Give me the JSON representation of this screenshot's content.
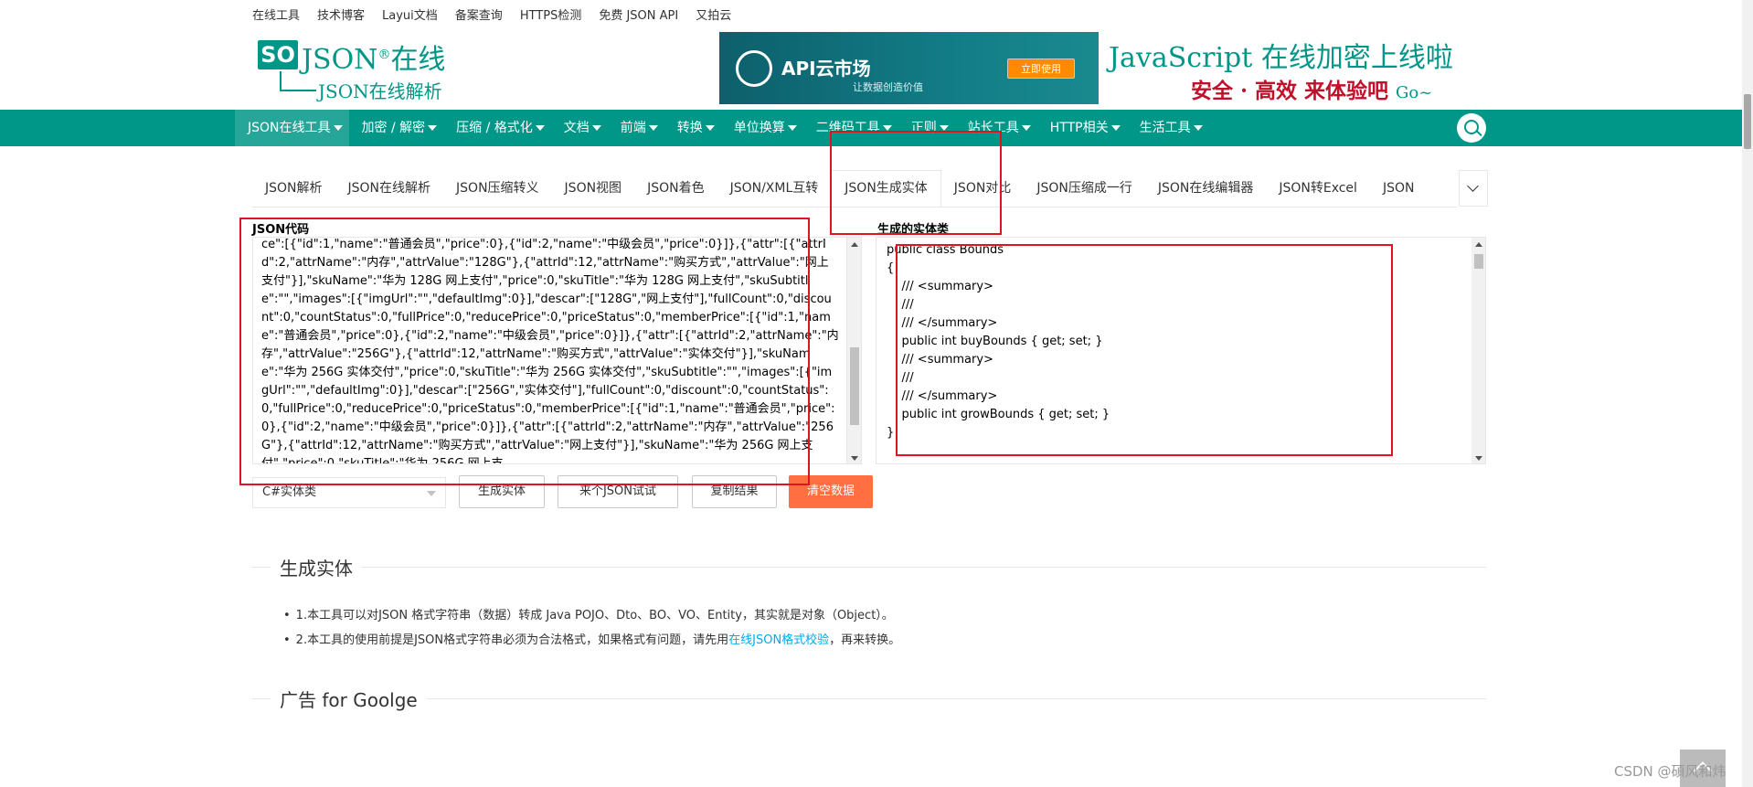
{
  "top_links": [
    "在线工具",
    "技术博客",
    "Layui文档",
    "备案查询",
    "HTTPS检测",
    "免费 JSON API",
    "又拍云"
  ],
  "logo": {
    "badge": "SO",
    "title": "JSON",
    "reg": "®",
    "title_cn": "在线",
    "subtitle": "JSON在线解析"
  },
  "banner": {
    "title": "API云市场",
    "subtitle": "让数据创造价值",
    "button": "立即使用"
  },
  "slogan": {
    "line1": "JavaScript 在线加密上线啦",
    "line2": "安全 · 高效  来体验吧",
    "go": "Go~"
  },
  "nav": [
    {
      "label": "JSON在线工具",
      "active": true
    },
    {
      "label": "加密 / 解密"
    },
    {
      "label": "压缩 / 格式化"
    },
    {
      "label": "文档"
    },
    {
      "label": "前端"
    },
    {
      "label": "转换"
    },
    {
      "label": "单位换算"
    },
    {
      "label": "二维码工具"
    },
    {
      "label": "正则"
    },
    {
      "label": "站长工具"
    },
    {
      "label": "HTTP相关"
    },
    {
      "label": "生活工具"
    }
  ],
  "tabs": [
    "JSON解析",
    "JSON在线解析",
    "JSON压缩转义",
    "JSON视图",
    "JSON着色",
    "JSON/XML互转",
    "JSON生成实体",
    "JSON对比",
    "JSON压缩成一行",
    "JSON在线编辑器",
    "JSON转Excel",
    "JSON"
  ],
  "active_tab": "JSON生成实体",
  "input": {
    "label": "JSON代码",
    "text": "ce\":[{\"id\":1,\"name\":\"普通会员\",\"price\":0},{\"id\":2,\"name\":\"中级会员\",\"price\":0}]},{\"attr\":[{\"attrId\":2,\"attrName\":\"内存\",\"attrValue\":\"128G\"},{\"attrId\":12,\"attrName\":\"购买方式\",\"attrValue\":\"网上支付\"}],\"skuName\":\"华为 128G 网上支付\",\"price\":0,\"skuTitle\":\"华为 128G 网上支付\",\"skuSubtitle\":\"\",\"images\":[{\"imgUrl\":\"\",\"defaultImg\":0}],\"descar\":[\"128G\",\"网上支付\"],\"fullCount\":0,\"discount\":0,\"countStatus\":0,\"fullPrice\":0,\"reducePrice\":0,\"priceStatus\":0,\"memberPrice\":[{\"id\":1,\"name\":\"普通会员\",\"price\":0},{\"id\":2,\"name\":\"中级会员\",\"price\":0}]},{\"attr\":[{\"attrId\":2,\"attrName\":\"内存\",\"attrValue\":\"256G\"},{\"attrId\":12,\"attrName\":\"购买方式\",\"attrValue\":\"实体交付\"}],\"skuName\":\"华为 256G 实体交付\",\"price\":0,\"skuTitle\":\"华为 256G 实体交付\",\"skuSubtitle\":\"\",\"images\":[{\"imgUrl\":\"\",\"defaultImg\":0}],\"descar\":[\"256G\",\"实体交付\"],\"fullCount\":0,\"discount\":0,\"countStatus\":0,\"fullPrice\":0,\"reducePrice\":0,\"priceStatus\":0,\"memberPrice\":[{\"id\":1,\"name\":\"普通会员\",\"price\":0},{\"id\":2,\"name\":\"中级会员\",\"price\":0}]},{\"attr\":[{\"attrId\":2,\"attrName\":\"内存\",\"attrValue\":\"256G\"},{\"attrId\":12,\"attrName\":\"购买方式\",\"attrValue\":\"网上支付\"}],\"skuName\":\"华为 256G 网上支付\",\"price\":0,\"skuTitle\":\"华为 256G 网上支"
  },
  "output": {
    "label": "生成的实体类",
    "code": "public class Bounds\n{\n    /// <summary>\n    /// \n    /// </summary>\n    public int buyBounds { get; set; }\n    /// <summary>\n    /// \n    /// </summary>\n    public int growBounds { get; set; }\n}"
  },
  "controls": {
    "language": "C#实体类",
    "generate": "生成实体",
    "try_json": "来个JSON试试",
    "copy": "复制结果",
    "clear": "清空数据"
  },
  "section1": {
    "title": "生成实体",
    "note1": "1.本工具可以对JSON 格式字符串（数据）转成 Java POJO、Dto、BO、VO、Entity，其实就是对象（Object）。",
    "note2_pre": "2.本工具的使用前提是JSON格式字符串必须为合法格式，如果格式有问题，请先用",
    "note2_link": "在线JSON格式校验",
    "note2_post": "，再来转换。"
  },
  "section2": {
    "title": "广告 for Goolge"
  },
  "watermark": "CSDN @碩风和炜",
  "colors": {
    "primary": "#009688",
    "warn": "#ff5722",
    "annotation": "#e0141e",
    "link": "#01AAED"
  }
}
